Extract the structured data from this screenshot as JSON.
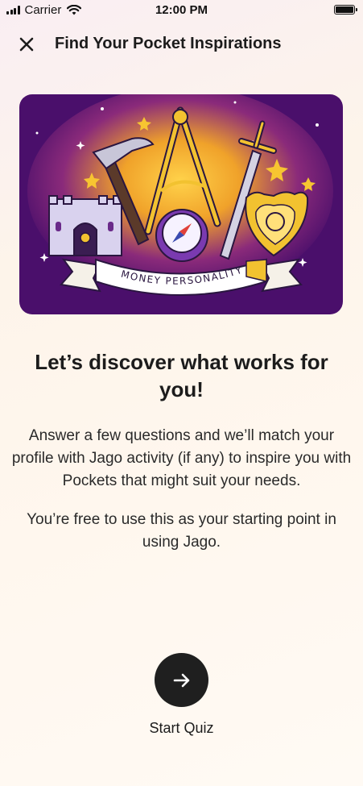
{
  "status_bar": {
    "carrier": "Carrier",
    "time": "12:00 PM"
  },
  "header": {
    "title": "Find Your Pocket Inspirations",
    "close_icon": "close-icon"
  },
  "illustration": {
    "banner_text": "MONEY PERSONALITY",
    "colors": {
      "background": "#4a0f6b",
      "glow": "#f0a22a",
      "gold": "#f2c230",
      "silver": "#c8c6d8"
    }
  },
  "content": {
    "headline": "Let’s discover what works for you!",
    "paragraph_1": "Answer a few questions and we’ll match your profile with Jago activity (if any) to inspire you with Pockets that might suit your needs.",
    "paragraph_2": "You’re free to use this as your starting point in using Jago."
  },
  "cta": {
    "icon": "arrow-right-icon",
    "label": "Start Quiz",
    "button_color": "#1f1f1f"
  }
}
